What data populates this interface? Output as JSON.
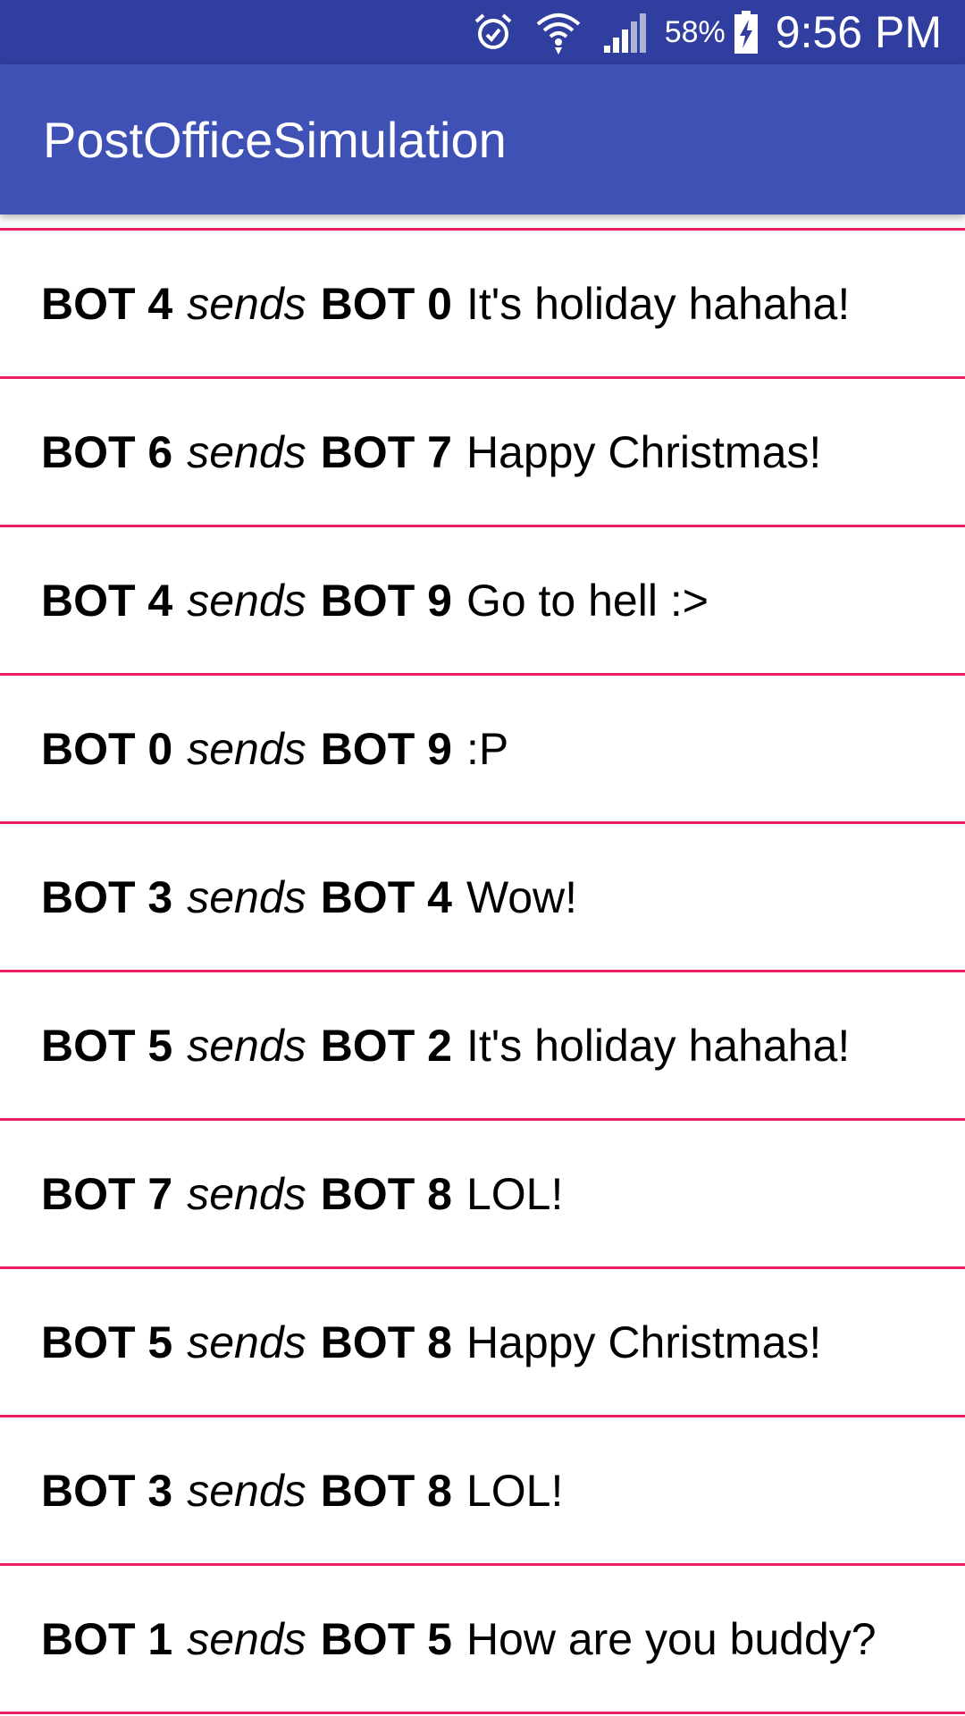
{
  "status_bar": {
    "battery_percent": "58%",
    "time": "9:56 PM",
    "icons": [
      "alarm-icon",
      "wifi-icon",
      "cell-signal-icon",
      "battery-charging-icon"
    ],
    "background": "#303F9F"
  },
  "app_bar": {
    "title": "PostOfficeSimulation",
    "background": "#3F51B5"
  },
  "divider_color": "#E91E63",
  "messages": [
    {
      "sender": "BOT 4",
      "verb": "sends",
      "receiver": "BOT 0",
      "text": "It's holiday hahaha!"
    },
    {
      "sender": "BOT 6",
      "verb": "sends",
      "receiver": "BOT 7",
      "text": "Happy Christmas!"
    },
    {
      "sender": "BOT 4",
      "verb": "sends",
      "receiver": "BOT 9",
      "text": "Go to hell :>"
    },
    {
      "sender": "BOT 0",
      "verb": "sends",
      "receiver": "BOT 9",
      "text": ":P"
    },
    {
      "sender": "BOT 3",
      "verb": "sends",
      "receiver": "BOT 4",
      "text": "Wow!"
    },
    {
      "sender": "BOT 5",
      "verb": "sends",
      "receiver": "BOT 2",
      "text": "It's holiday hahaha!"
    },
    {
      "sender": "BOT 7",
      "verb": "sends",
      "receiver": "BOT 8",
      "text": "LOL!"
    },
    {
      "sender": "BOT 5",
      "verb": "sends",
      "receiver": "BOT 8",
      "text": "Happy Christmas!"
    },
    {
      "sender": "BOT 3",
      "verb": "sends",
      "receiver": "BOT 8",
      "text": "LOL!"
    },
    {
      "sender": "BOT 1",
      "verb": "sends",
      "receiver": "BOT 5",
      "text": "How are you buddy?"
    }
  ]
}
